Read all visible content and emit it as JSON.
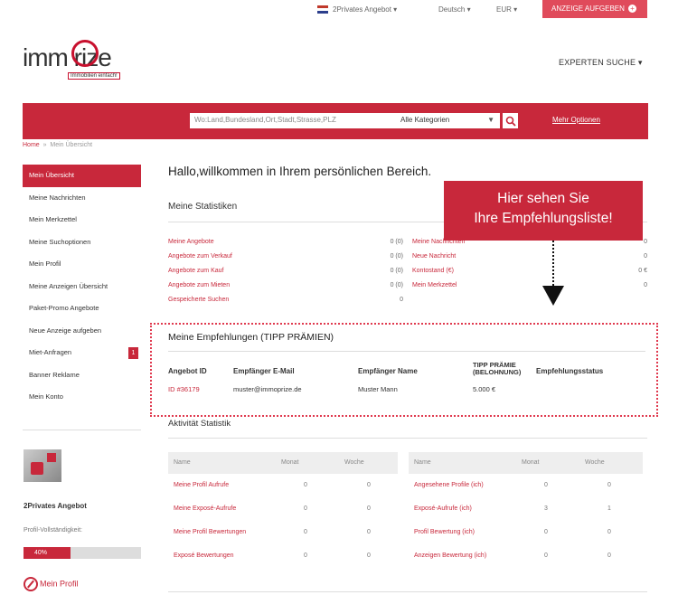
{
  "topbar": {
    "profile_menu": "2Privates Angebot",
    "language": "Deutsch",
    "currency": "EUR",
    "ad_button": "ANZEIGE AUFGEBEN"
  },
  "logo": {
    "text": "imm   rize",
    "subtitle": "Immobilien einfach!"
  },
  "header": {
    "experten": "EXPERTEN SUCHE"
  },
  "search": {
    "placeholder": "Wo:Land,Bundesland,Ort,Stadt,Strasse,PLZ",
    "category": "Alle Kategorien",
    "more_options": "Mehr Optionen"
  },
  "breadcrumb": {
    "home": "Home",
    "separator": "»",
    "current": "Mein Übersicht"
  },
  "sidebar": {
    "items": [
      {
        "label": "Mein Übersicht",
        "active": true
      },
      {
        "label": "Meine Nachrichten"
      },
      {
        "label": "Mein Merkzettel"
      },
      {
        "label": "Meine Suchoptionen"
      },
      {
        "label": "Mein Profil"
      },
      {
        "label": "Meine Anzeigen Übersicht"
      },
      {
        "label": "Paket-Promo Angebote"
      },
      {
        "label": "Neue Anzeige aufgeben"
      },
      {
        "label": "Miet-Anfragen",
        "badge": "1"
      },
      {
        "label": "Banner Reklame"
      },
      {
        "label": "Mein Konto"
      }
    ]
  },
  "profile": {
    "name": "2Privates Angebot",
    "completeness_label": "Profil-Vollständigkeit:",
    "completeness_value": "40%",
    "completeness_fraction": 0.4,
    "my_profile_link": "Mein Profil"
  },
  "main": {
    "welcome": "Hallo,willkommen in Ihrem persönlichen Bereich.",
    "stats_title": "Meine Statistiken",
    "stats_left": [
      {
        "label": "Meine Angebote",
        "value": "0 (0)"
      },
      {
        "label": "Angebote zum Verkauf",
        "value": "0 (0)"
      },
      {
        "label": "Angebote zum Kauf",
        "value": "0 (0)"
      },
      {
        "label": "Angebote zum Mieten",
        "value": "0 (0)"
      },
      {
        "label": "Gespeicherte Suchen",
        "value": "0"
      }
    ],
    "stats_right": [
      {
        "label": "Meine Nachrichten",
        "value": "0"
      },
      {
        "label": "Neue Nachricht",
        "value": "0"
      },
      {
        "label": "Kontostand (€)",
        "value": "0 €"
      },
      {
        "label": "Mein Merkzettel",
        "value": "0"
      }
    ]
  },
  "callout": {
    "line1": "Hier sehen Sie",
    "line2": "Ihre Empfehlungsliste!"
  },
  "recommendations": {
    "title": "Meine Empfehlungen (TIPP PRÄMIEN)",
    "headers": {
      "offer_id": "Angebot ID",
      "email": "Empfänger E-Mail",
      "name": "Empfänger Name",
      "bonus_line1": "TIPP PRÄMIE",
      "bonus_line2": "(BELOHNUNG)",
      "status": "Empfehlungsstatus"
    },
    "rows": [
      {
        "offer_id": "ID #36179",
        "email": "muster@immoprize.de",
        "name": "Muster Mann",
        "bonus": "5.000 €",
        "status": ""
      }
    ]
  },
  "activity": {
    "title": "Aktivität Statistik",
    "left": {
      "headers": [
        "Name",
        "Monat",
        "Woche"
      ],
      "rows": [
        {
          "name": "Meine Profil Aufrufe",
          "month": "0",
          "week": "0"
        },
        {
          "name": "Meine Exposé-Aufrufe",
          "month": "0",
          "week": "0"
        },
        {
          "name": "Meine Profil Bewertungen",
          "month": "0",
          "week": "0"
        },
        {
          "name": "Exposé Bewertungen",
          "month": "0",
          "week": "0"
        }
      ]
    },
    "right": {
      "headers": [
        "Name",
        "Monat",
        "Woche"
      ],
      "rows": [
        {
          "name": "Angesehene Profile (ich)",
          "month": "0",
          "week": "0"
        },
        {
          "name": "Exposé-Aufrufe (ich)",
          "month": "3",
          "week": "1"
        },
        {
          "name": "Profil Bewertung (ich)",
          "month": "0",
          "week": "0"
        },
        {
          "name": "Anzeigen Bewertung (ich)",
          "month": "0",
          "week": "0"
        }
      ]
    }
  },
  "colors": {
    "brand_red": "#c8283b",
    "callout_red": "#c8283b"
  }
}
